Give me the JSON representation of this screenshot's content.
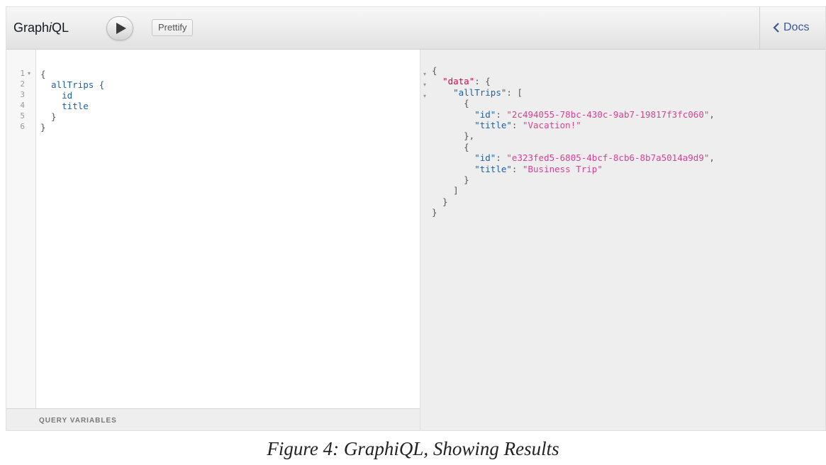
{
  "topbar": {
    "title_prefix": "Graph",
    "title_italic": "i",
    "title_suffix": "QL",
    "run_icon": "play-icon",
    "prettify_label": "Prettify",
    "docs_label": "Docs",
    "docs_icon": "chevron-left-icon"
  },
  "editor": {
    "line_numbers": [
      "1",
      "2",
      "3",
      "4",
      "5",
      "6"
    ],
    "lines": [
      "{",
      "  allTrips {",
      "    id",
      "    title",
      "  }",
      "}"
    ],
    "query_variables_label": "QUERY VARIABLES"
  },
  "result": {
    "data_key": "\"data\"",
    "alltrips_key": "\"allTrips\"",
    "items": [
      {
        "id_key": "\"id\"",
        "id_value": "\"2c494055-78bc-430c-9ab7-19817f3fc060\"",
        "title_key": "\"title\"",
        "title_value": "\"Vacation!\""
      },
      {
        "id_key": "\"id\"",
        "id_value": "\"e323fed5-6805-4bcf-8cb6-8b7a5014a9d9\"",
        "title_key": "\"title\"",
        "title_value": "\"Business Trip\""
      }
    ]
  },
  "caption": "Figure 4: GraphiQL, Showing Results",
  "colors": {
    "field": "#1f61a0",
    "data_key": "#d2054e",
    "string": "#d64292",
    "docs_link": "#3b5998"
  }
}
